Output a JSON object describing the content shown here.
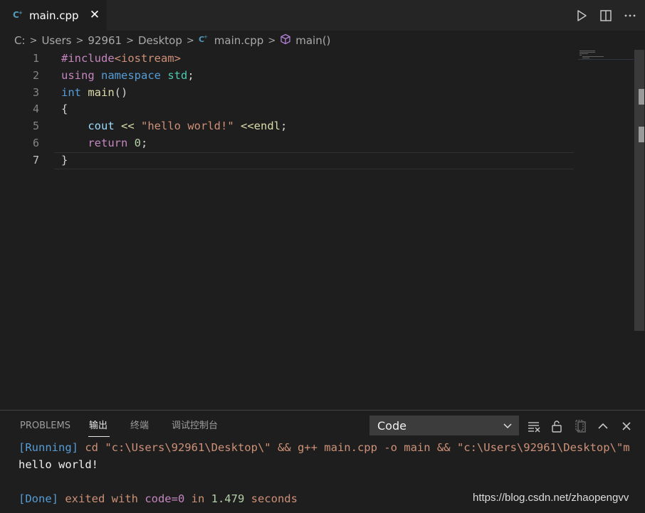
{
  "tab": {
    "title": "main.cpp",
    "icon": "cpp-file-icon"
  },
  "editor_actions": [
    "run-icon",
    "split-editor-icon",
    "more-icon"
  ],
  "breadcrumb": {
    "items": [
      "C:",
      "Users",
      "92961",
      "Desktop",
      "main.cpp",
      "main()"
    ]
  },
  "code": {
    "line_numbers": [
      "1",
      "2",
      "3",
      "4",
      "5",
      "6",
      "7"
    ],
    "lines": [
      [
        {
          "t": "#include",
          "c": "kw"
        },
        {
          "t": "<iostream>",
          "c": "inc"
        }
      ],
      [
        {
          "t": "using ",
          "c": "kw"
        },
        {
          "t": "namespace ",
          "c": "kw2"
        },
        {
          "t": "std",
          "c": "ns"
        },
        {
          "t": ";",
          "c": "pun"
        }
      ],
      [
        {
          "t": "int ",
          "c": "kw2"
        },
        {
          "t": "main",
          "c": "fn"
        },
        {
          "t": "()",
          "c": "pun"
        }
      ],
      [
        {
          "t": "{",
          "c": "pun"
        }
      ],
      [
        {
          "t": "    cout ",
          "c": "var"
        },
        {
          "t": "<< ",
          "c": "fn"
        },
        {
          "t": "\"hello world!\" ",
          "c": "str"
        },
        {
          "t": "<<",
          "c": "fn"
        },
        {
          "t": "endl",
          "c": "fn"
        },
        {
          "t": ";",
          "c": "pun"
        }
      ],
      [
        {
          "t": "    return ",
          "c": "kw"
        },
        {
          "t": "0",
          "c": "num"
        },
        {
          "t": ";",
          "c": "pun"
        }
      ],
      [
        {
          "t": "}",
          "c": "pun"
        }
      ]
    ],
    "active_line": 7
  },
  "panel": {
    "tabs": [
      "PROBLEMS",
      "输出",
      "终端",
      "调试控制台"
    ],
    "active_tab": "输出",
    "output_channel": "Code",
    "output_lines": [
      [
        {
          "t": "[Running] ",
          "c": "o-blue"
        },
        {
          "t": "cd ",
          "c": "o-orange"
        },
        {
          "t": "\"c:\\Users\\92961\\Desktop\\\" ",
          "c": "o-orange"
        },
        {
          "t": "&& g++ main.cpp -o main && ",
          "c": "o-orange"
        },
        {
          "t": "\"c:\\Users\\92961\\Desktop\\\"m",
          "c": "o-orange"
        }
      ],
      [
        {
          "t": "hello world!",
          "c": "o-white"
        }
      ],
      [],
      [
        {
          "t": "[Done] ",
          "c": "o-blue"
        },
        {
          "t": "exited with ",
          "c": "o-orange"
        },
        {
          "t": "code=0 ",
          "c": "o-purple"
        },
        {
          "t": "in ",
          "c": "o-orange"
        },
        {
          "t": "1.479 ",
          "c": "o-green"
        },
        {
          "t": "seconds",
          "c": "o-orange"
        }
      ]
    ]
  },
  "watermark": "https://blog.csdn.net/zhaopengvv"
}
